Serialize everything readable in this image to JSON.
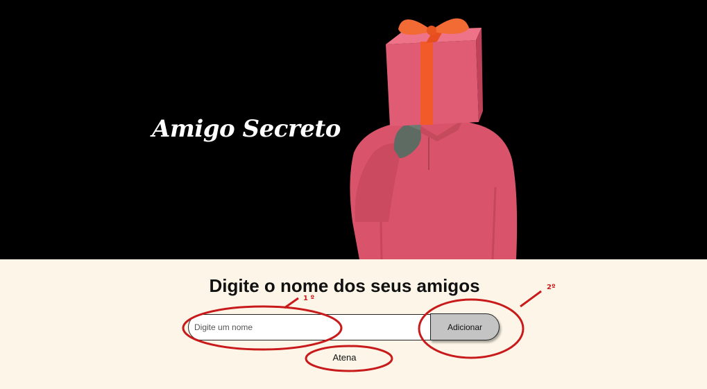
{
  "hero": {
    "title": "Amigo Secreto",
    "background_color": "#000000",
    "image_icon": "gift-box-head-person-icon"
  },
  "main": {
    "heading": "Digite o nome dos seus amigos",
    "input": {
      "value": "",
      "placeholder": "Digite um nome"
    },
    "add_button_label": "Adicionar",
    "friends": [
      "Atena"
    ],
    "background_color": "#fdf6e8"
  },
  "annotations": {
    "color": "#c81a1a",
    "labels": [
      "1 º",
      "2º"
    ]
  }
}
